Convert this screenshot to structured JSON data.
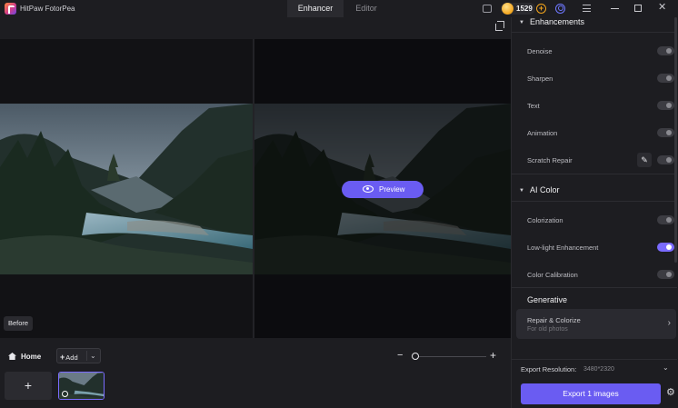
{
  "window": {
    "app_title": "HitPaw FotorPea",
    "tabs": [
      "Enhancer",
      "Editor"
    ],
    "credits": "1529"
  },
  "canvas": {
    "preview_label": "Preview",
    "before_label": "Before"
  },
  "bottom": {
    "home_label": "Home",
    "add_label": "Add",
    "add_tile_glyph": "+"
  },
  "panel": {
    "enhancements": {
      "title": "Enhancements",
      "items": [
        {
          "label": "Denoise",
          "on": false
        },
        {
          "label": "Sharpen",
          "on": false
        },
        {
          "label": "Text",
          "on": false
        },
        {
          "label": "Animation",
          "on": false
        },
        {
          "label": "Scratch Repair",
          "on": false
        }
      ]
    },
    "ai_color": {
      "title": "AI Color",
      "items": [
        {
          "label": "Colorization",
          "on": false
        },
        {
          "label": "Low-light Enhancement",
          "on": true
        },
        {
          "label": "Color Calibration",
          "on": false
        }
      ]
    },
    "generative": {
      "title": "Generative",
      "card_title": "Repair & Colorize",
      "card_subtitle": "For old photos"
    },
    "export": {
      "resolution_label": "Export Resolution:",
      "resolution_value": "3480*2320",
      "button_label": "Export 1 images"
    }
  },
  "colors": {
    "accent": "#6a5cf2",
    "toggle_on": "#7a6bff"
  }
}
